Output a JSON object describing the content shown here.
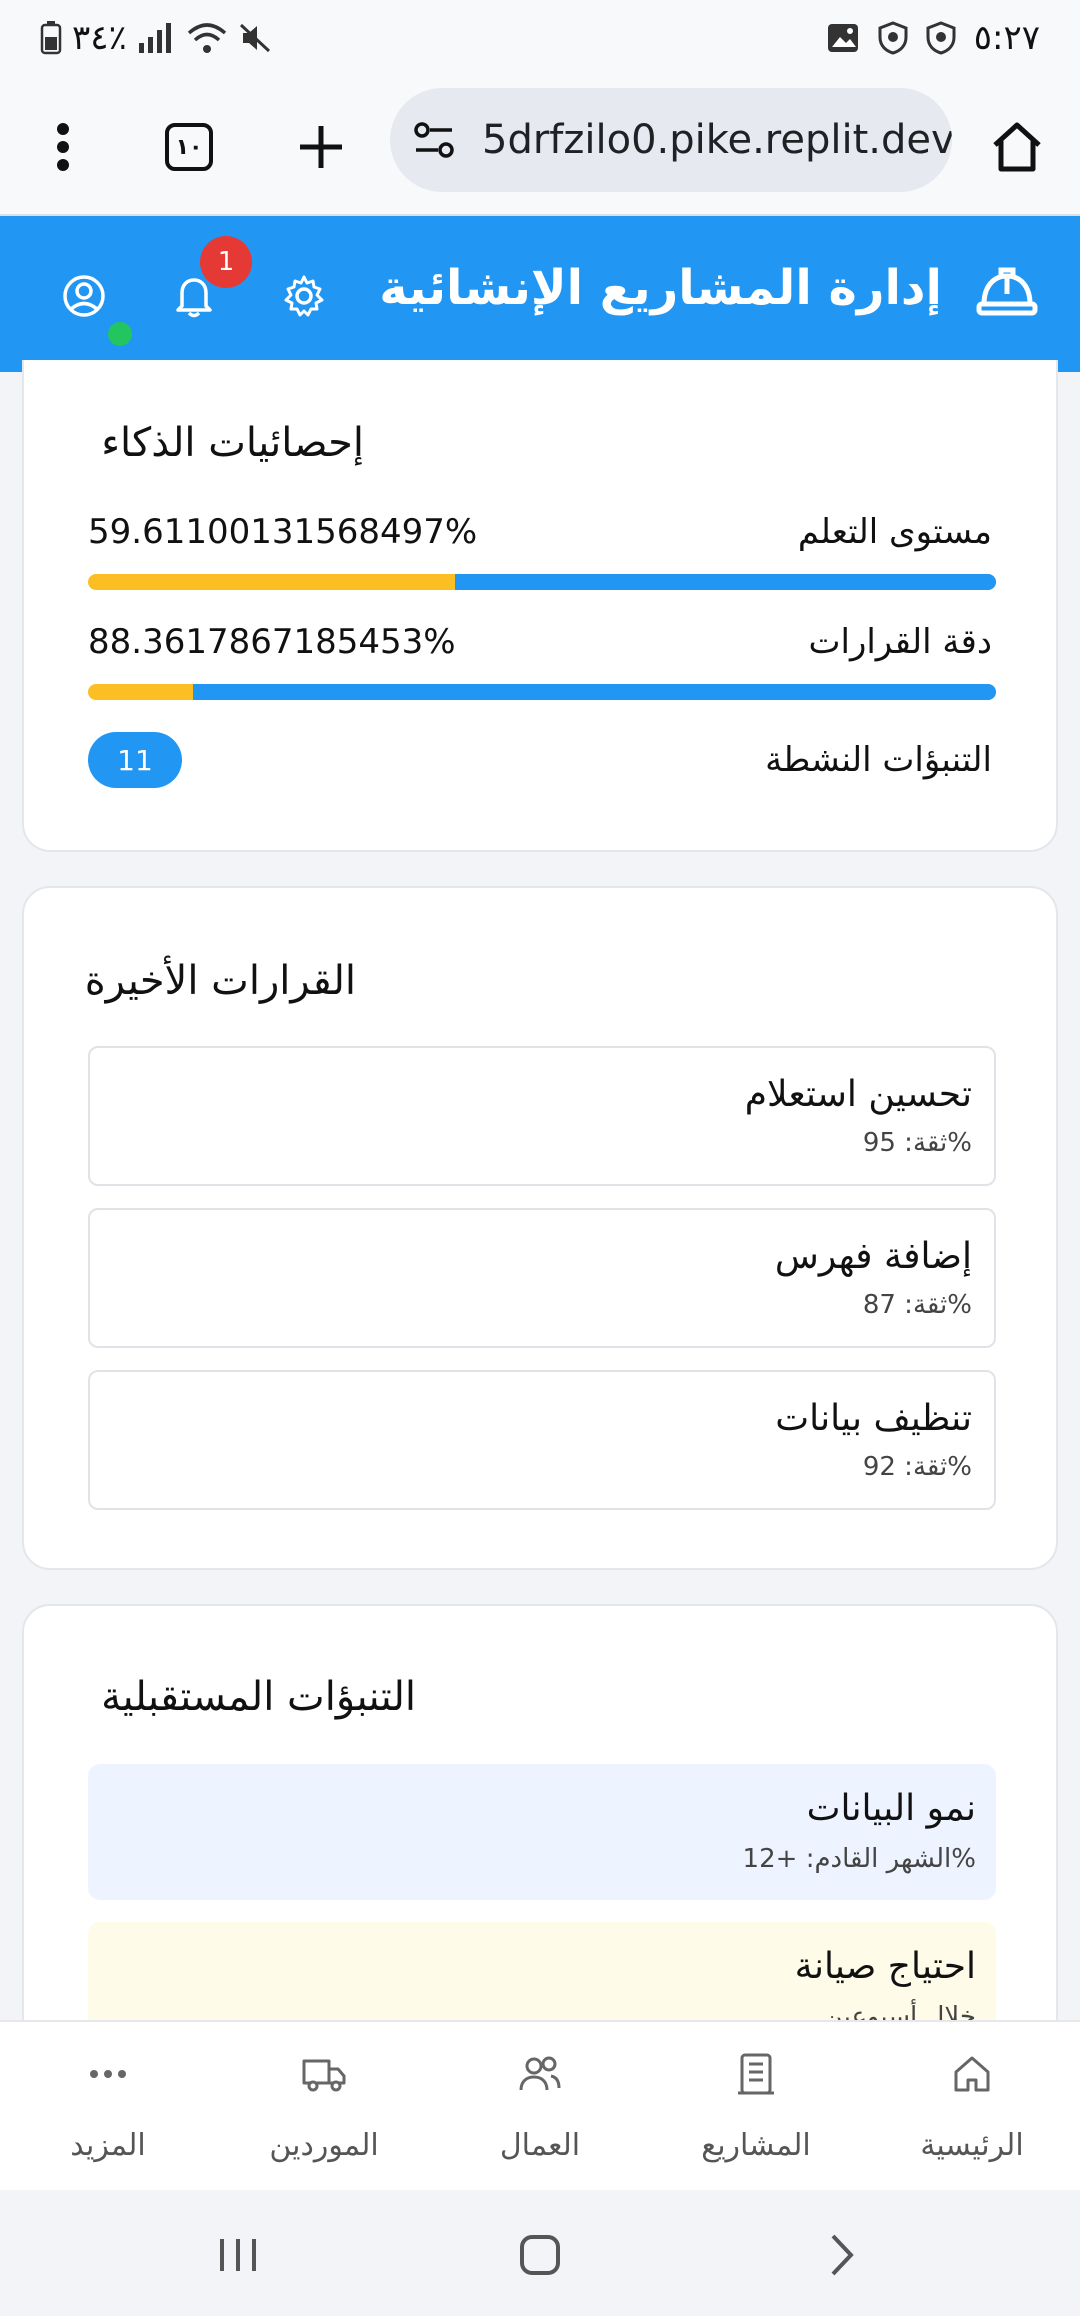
{
  "status_bar": {
    "battery": "٣٤٪",
    "time": "٥:٢٧"
  },
  "browser": {
    "url": "5drfzilo0.pike.replit.dev",
    "tab_count": "١٠"
  },
  "app": {
    "title": "إدارة المشاريع الإنشائية",
    "notification_count": "1",
    "colors": {
      "primary": "#2196f3",
      "accent": "#fbbf24",
      "badge": "#e53935",
      "online": "#22c55e"
    }
  },
  "ai_stats": {
    "title": "إحصائيات الذكاء",
    "learning_label": "مستوى التعلم",
    "learning_value": "59.61100131568497%",
    "learning_fraction": 0.596,
    "accuracy_label": "دقة القرارات",
    "accuracy_value": "88.3617867185453%",
    "accuracy_fraction": 0.884,
    "active_predictions_label": "التنبؤات النشطة",
    "active_predictions_count": "11"
  },
  "recent_decisions": {
    "title": "القرارات الأخيرة",
    "items": [
      {
        "title": "تحسين استعلام",
        "confidence": "ثقة: 95%"
      },
      {
        "title": "إضافة فهرس",
        "confidence": "ثقة: 87%"
      },
      {
        "title": "تنظيف بيانات",
        "confidence": "ثقة: 92%"
      }
    ]
  },
  "future_predictions": {
    "title": "التنبؤات المستقبلية",
    "items": [
      {
        "title": "نمو البيانات",
        "detail": "الشهر القادم: +12%",
        "color": "#eef4ff"
      },
      {
        "title": "احتياج صيانة",
        "detail": "خلال أسبوعين",
        "color": "#fefbe8"
      }
    ]
  },
  "bottom_nav": {
    "items": [
      {
        "label": "الرئيسية",
        "icon": "home-icon"
      },
      {
        "label": "المشاريع",
        "icon": "building-icon"
      },
      {
        "label": "العمال",
        "icon": "users-icon"
      },
      {
        "label": "الموردين",
        "icon": "truck-icon"
      },
      {
        "label": "المزيد",
        "icon": "more-icon"
      }
    ]
  }
}
